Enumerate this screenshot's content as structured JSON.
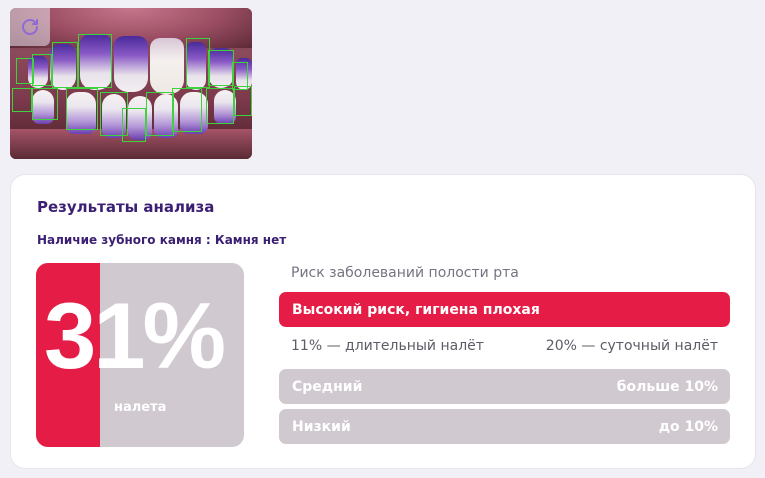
{
  "refresh_icon": "refresh-icon",
  "results": {
    "title": "Результаты анализа",
    "tartar_label": "Наличие зубного камня : Камня нет"
  },
  "plaque": {
    "percent_text": "31%",
    "percent_value": 31,
    "unit_label": "налета",
    "accent_color": "#e51d46",
    "muted_color": "#d0c9d0"
  },
  "risk": {
    "caption": "Риск заболеваний полости рта",
    "high_label": "Высокий риск, гигиена плохая",
    "note_long": "11% — длительный налёт",
    "note_daily": "20% — суточный налёт",
    "levels": [
      {
        "label": "Средний",
        "range": "больше 10%"
      },
      {
        "label": "Низкий",
        "range": "до 10%"
      }
    ]
  }
}
